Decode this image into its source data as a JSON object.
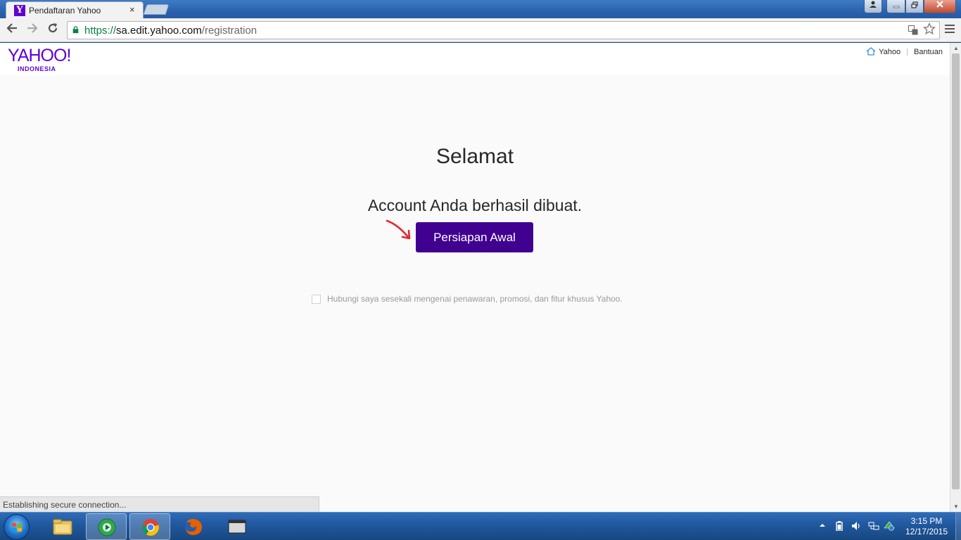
{
  "browser": {
    "tab_title": "Pendaftaran Yahoo",
    "tab_favicon_letter": "Y",
    "tab_close_glyph": "×",
    "url_scheme": "https://",
    "url_host": "sa.edit.yahoo.com",
    "url_path": "/registration",
    "status_text": "Establishing secure connection..."
  },
  "header": {
    "logo_text": "YAHOO!",
    "logo_country": "INDONESIA",
    "link_home": "Yahoo",
    "link_help": "Bantuan"
  },
  "main": {
    "title": "Selamat",
    "message": "Account Anda berhasil dibuat.",
    "button_label": "Persiapan Awal",
    "optin_label": "Hubungi saya sesekali mengenai penawaran, promosi, dan fitur khusus Yahoo.",
    "optin_checked": false
  },
  "taskbar": {
    "apps": [
      "windows-explorer",
      "media-player",
      "google-chrome",
      "firefox",
      "window"
    ],
    "active_app": "google-chrome",
    "clock_time": "3:15 PM",
    "clock_date": "12/17/2015"
  },
  "colors": {
    "yahoo_purple": "#5f01d1",
    "button_purple": "#400090",
    "annotation_red": "#e8262f",
    "secure_green": "#0b8043"
  },
  "icons": {
    "tray": [
      "show-hidden-icons-icon",
      "battery-icon",
      "volume-icon",
      "network-icon",
      "action-center-icon"
    ]
  }
}
